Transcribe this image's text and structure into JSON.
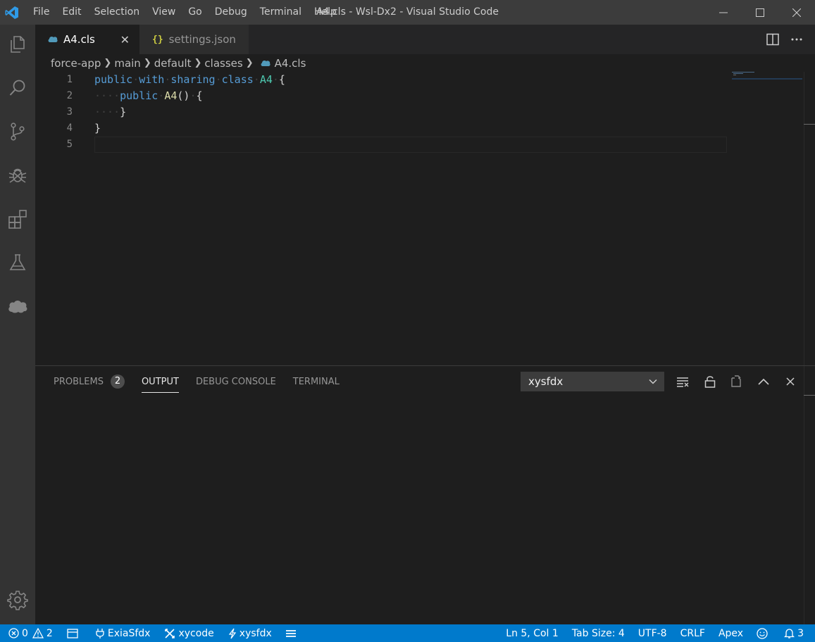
{
  "app": {
    "window_title": "A4.cls - Wsl-Dx2 - Visual Studio Code",
    "brand_color": "#007acc"
  },
  "menu": [
    "File",
    "Edit",
    "Selection",
    "View",
    "Go",
    "Debug",
    "Terminal",
    "Help"
  ],
  "activity": [
    "explorer-icon",
    "search-icon",
    "source-control-icon",
    "debug-icon",
    "extensions-icon",
    "test-flask-icon",
    "salesforce-cloud-icon",
    "settings-gear-icon"
  ],
  "tabs": [
    {
      "label": "A4.cls",
      "icon": "apex-icon",
      "active": true
    },
    {
      "label": "settings.json",
      "icon": "json-braces-icon",
      "active": false
    }
  ],
  "breadcrumb": [
    "force-app",
    "main",
    "default",
    "classes",
    "A4.cls"
  ],
  "editor": {
    "line_numbers": [
      "1",
      "2",
      "3",
      "4",
      "5"
    ],
    "lines": [
      "public with sharing class A4 {",
      "    public A4() {",
      "    }",
      "}",
      ""
    ]
  },
  "panel": {
    "tabs": [
      {
        "label": "PROBLEMS",
        "badge": "2"
      },
      {
        "label": "OUTPUT",
        "active": true
      },
      {
        "label": "DEBUG CONSOLE"
      },
      {
        "label": "TERMINAL"
      }
    ],
    "output_channel": "xysfdx"
  },
  "status": {
    "errors": "0",
    "warnings": "2",
    "org_exia": "ExiaSfdx",
    "xycode": "xycode",
    "xysfdx": "xysfdx",
    "cursor": "Ln 5, Col 1",
    "tab_size": "Tab Size: 4",
    "encoding": "UTF-8",
    "eol": "CRLF",
    "language": "Apex",
    "notifications": "3"
  }
}
